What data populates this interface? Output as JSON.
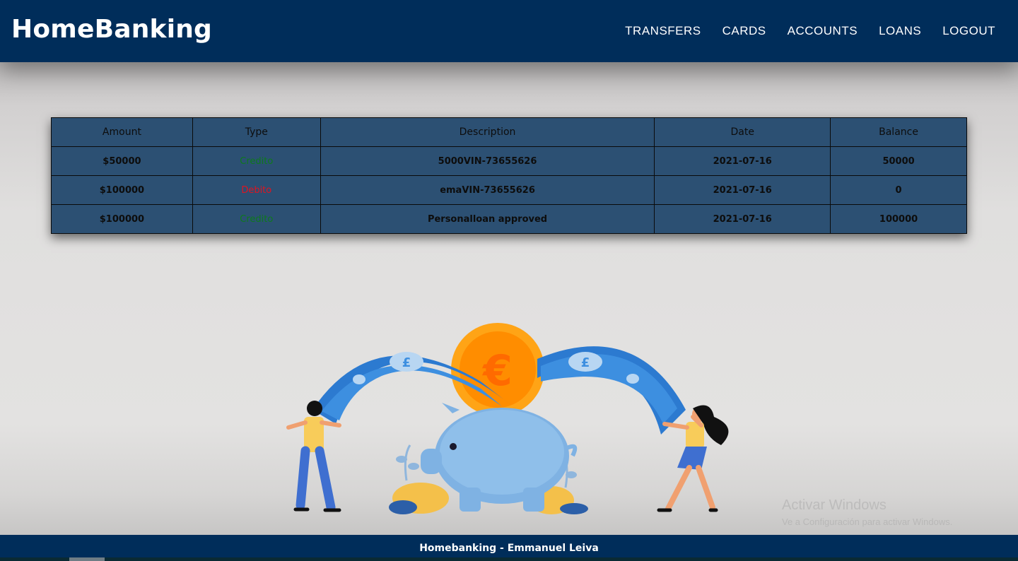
{
  "app": {
    "brand": "HomeBanking"
  },
  "nav": {
    "items": [
      {
        "label": "TRANSFERS"
      },
      {
        "label": "CARDS"
      },
      {
        "label": "ACCOUNTS"
      },
      {
        "label": "LOANS"
      },
      {
        "label": "LOGOUT"
      }
    ]
  },
  "table": {
    "headers": [
      "Amount",
      "Type",
      "Description",
      "Date",
      "Balance"
    ],
    "rows": [
      {
        "amount": "$50000",
        "type": "Credito",
        "description": "5000VIN-73655626",
        "date": "2021-07-16",
        "balance": "50000"
      },
      {
        "amount": "$100000",
        "type": "Debito",
        "description": "emaVIN-73655626",
        "date": "2021-07-16",
        "balance": "0"
      },
      {
        "amount": "$100000",
        "type": "Credito",
        "description": "Personalloan approved",
        "date": "2021-07-16",
        "balance": "100000"
      }
    ]
  },
  "colors": {
    "navbar": "#002d5a",
    "table_bg": "#2c5073",
    "credit": "#0d7a1c",
    "debit": "#e01420"
  },
  "illustration": {
    "icon": "piggy-bank-money-illustration",
    "currency_symbols": [
      "€",
      "£",
      "£"
    ]
  },
  "watermark": {
    "line1": "Activar Windows",
    "line2": "Ve a Configuración para activar Windows."
  },
  "footer": {
    "text": "Homebanking - Emmanuel Leiva"
  }
}
